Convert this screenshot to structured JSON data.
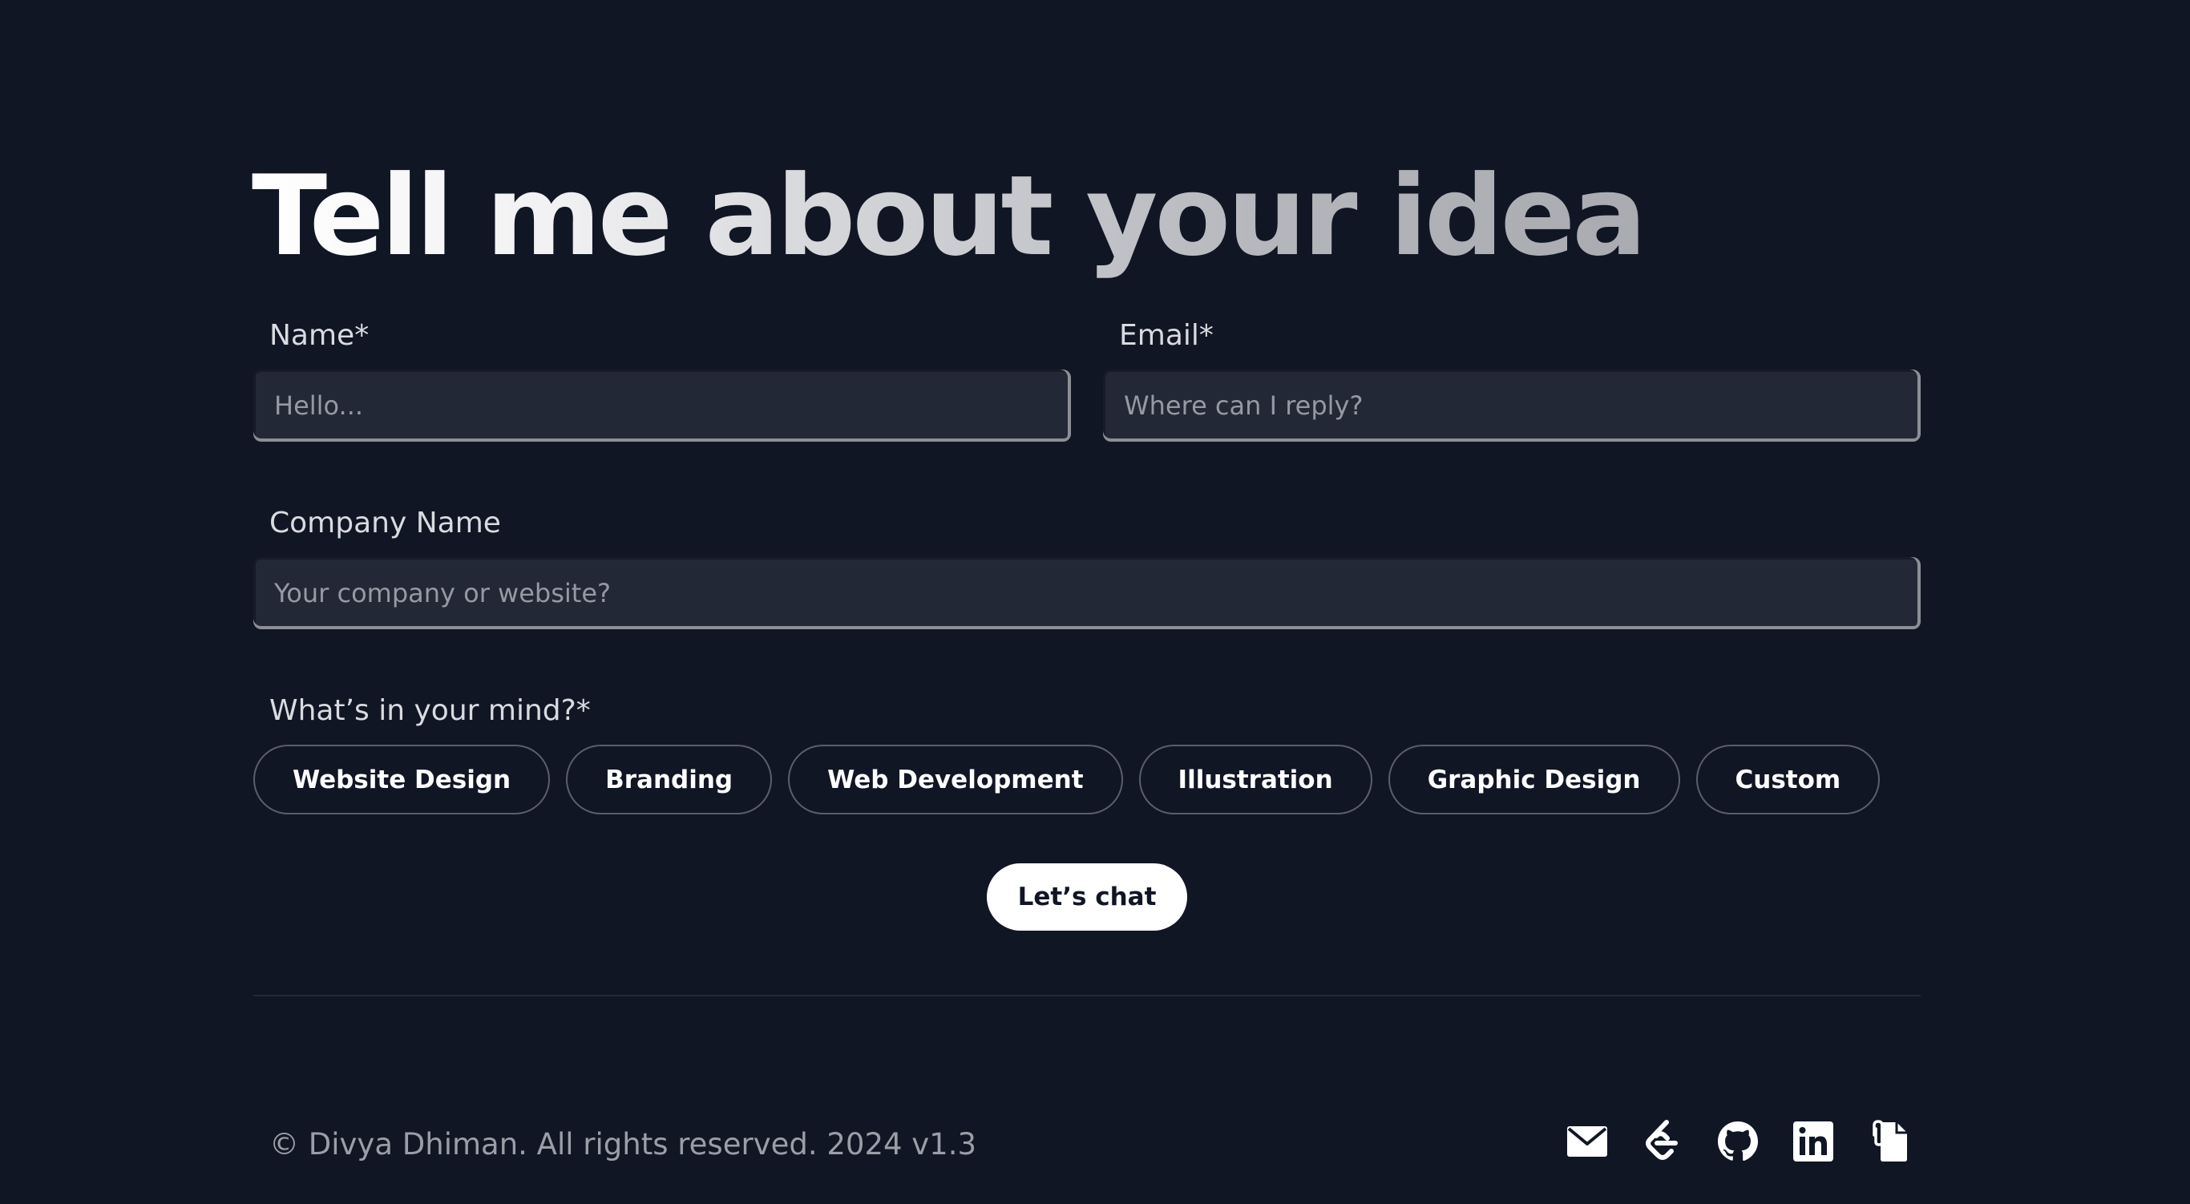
{
  "heading": "Tell me about your idea",
  "form": {
    "name_label": "Name*",
    "name_placeholder": "Hello...",
    "email_label": "Email*",
    "email_placeholder": "Where can I reply?",
    "company_label": "Company Name",
    "company_placeholder": "Your company or website?",
    "mind_label": "What’s in your mind?*",
    "options": [
      "Website Design",
      "Branding",
      "Web Development",
      "Illustration",
      "Graphic Design",
      "Custom"
    ],
    "submit_label": "Let’s chat"
  },
  "footer": {
    "copyright": "© Divya Dhiman. All rights reserved. 2024 v1.3",
    "socials": [
      {
        "name": "mail-icon",
        "label": "Email"
      },
      {
        "name": "leetcode-icon",
        "label": "LeetCode"
      },
      {
        "name": "github-icon",
        "label": "GitHub"
      },
      {
        "name": "linkedin-icon",
        "label": "LinkedIn"
      },
      {
        "name": "resume-icon",
        "label": "Resume"
      }
    ]
  },
  "colors": {
    "background": "#111625",
    "field_background": "#222835",
    "chip_border": "#5a5f6b",
    "cta_background": "#ffffff",
    "muted_text": "#9a9ea6"
  }
}
